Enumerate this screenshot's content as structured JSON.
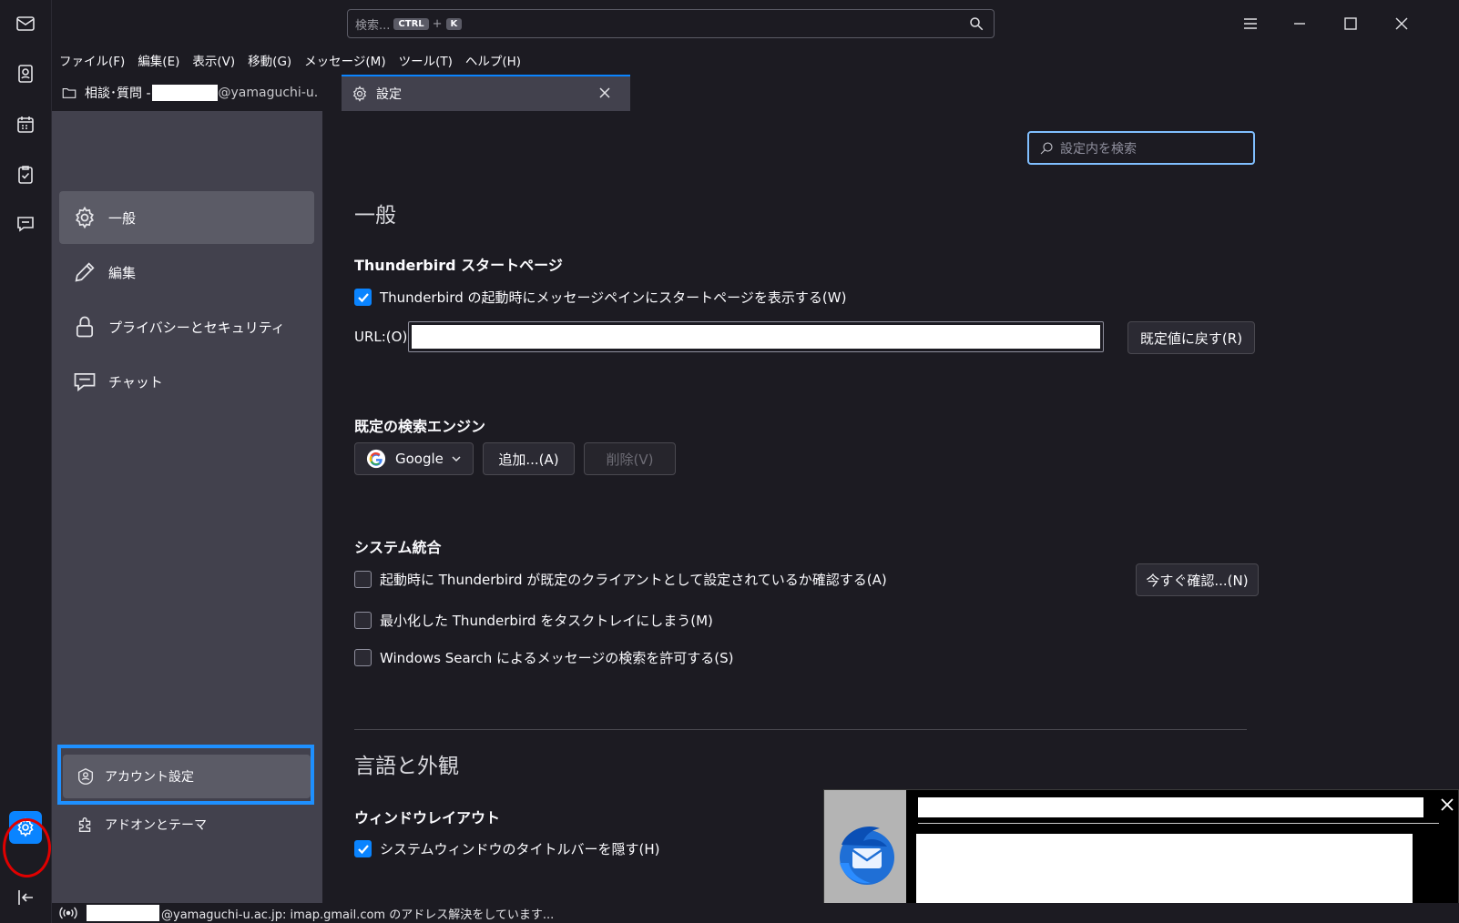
{
  "titlebar": {
    "search_placeholder": "検索...",
    "shortcut_ctrl": "CTRL",
    "shortcut_plus": "+",
    "shortcut_key": "K"
  },
  "menu": [
    "ファイル(F)",
    "編集(E)",
    "表示(V)",
    "移動(G)",
    "メッセージ(M)",
    "ツール(T)",
    "ヘルプ(H)"
  ],
  "tabs": {
    "folder_prefix": "相談･質問 -",
    "folder_suffix": "@yamaguchi-u.",
    "settings": "設定"
  },
  "prefnav": {
    "general": "一般",
    "compose": "編集",
    "privacy": "プライバシーとセキュリティ",
    "chat": "チャット",
    "account_settings": "アカウント設定",
    "addons": "アドオンとテーマ"
  },
  "main": {
    "find_placeholder": "設定内を検索",
    "general_heading": "一般",
    "startpage_heading": "Thunderbird スタートページ",
    "startpage_checkbox": "Thunderbird の起動時にメッセージペインにスタートページを表示する(W)",
    "startpage_checked": true,
    "url_label": "URL:(O)",
    "restore_default": "既定値に戻す(R)",
    "search_engine_heading": "既定の検索エンジン",
    "search_engine_value": "Google",
    "add_button": "追加...(A)",
    "remove_button": "削除(V)",
    "system_heading": "システム統合",
    "default_client_check": "起動時に Thunderbird が既定のクライアントとして設定されているか確認する(A)",
    "check_now_button": "今すぐ確認...(N)",
    "tray_check": "最小化した Thunderbird をタスクトレイにしまう(M)",
    "windows_search_check": "Windows Search によるメッセージの検索を許可する(S)",
    "language_heading": "言語と外観",
    "window_layout_heading": "ウィンドウレイアウト",
    "hide_titlebar_check": "システムウィンドウのタイトルバーを隠す(H)",
    "hide_titlebar_checked": true
  },
  "status": {
    "text": "@yamaguchi-u.ac.jp: imap.gmail.com のアドレス解決をしています..."
  },
  "colors": {
    "accent": "#0a84ff",
    "highlight_frame": "#1e90ff",
    "annotation_ring": "#e00000"
  }
}
